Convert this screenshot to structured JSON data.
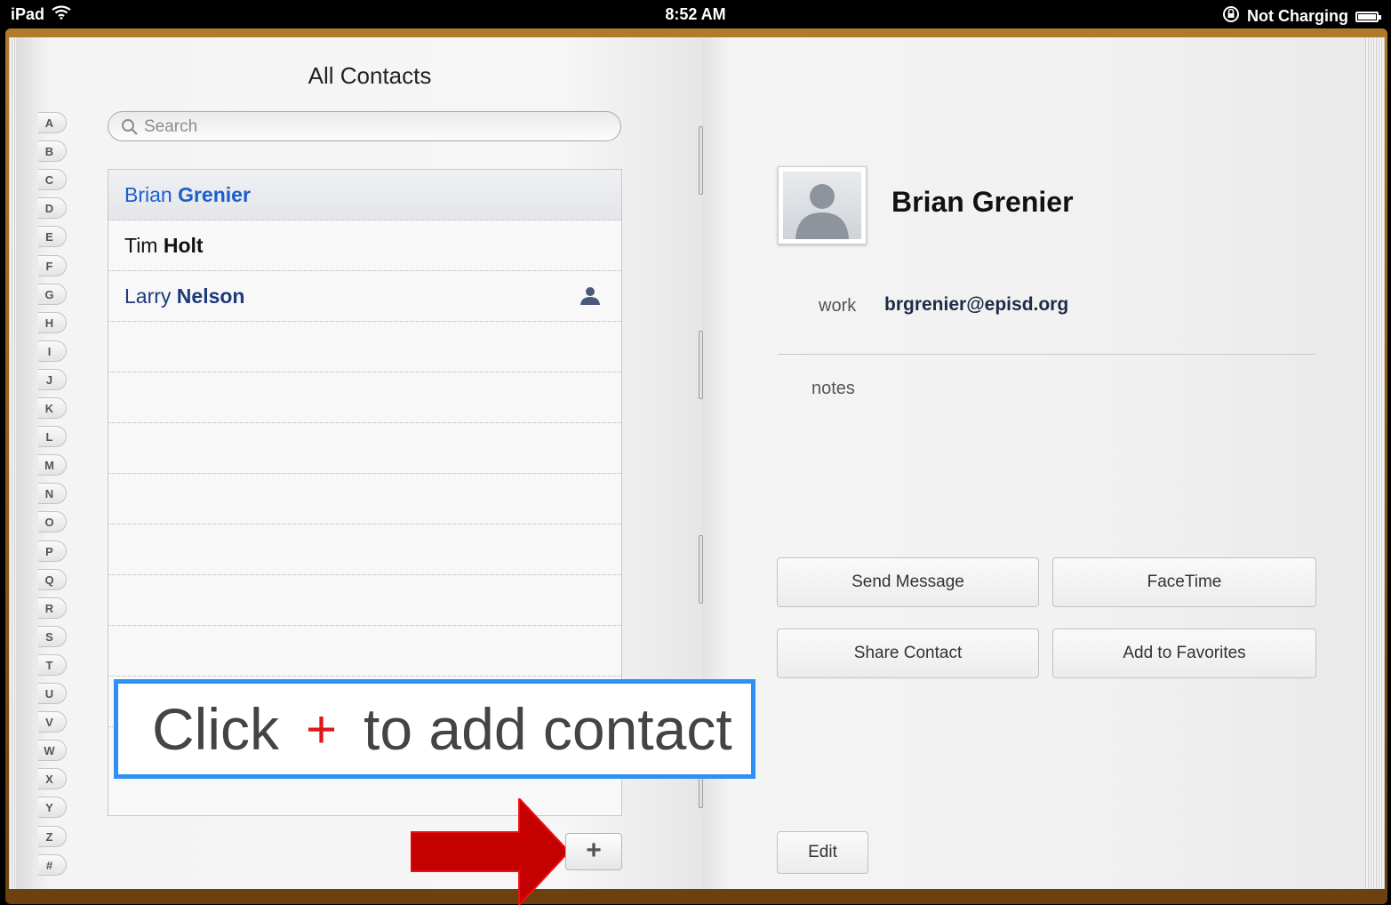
{
  "status_bar": {
    "device": "iPad",
    "time": "8:52 AM",
    "charging": "Not Charging"
  },
  "contacts_list": {
    "title": "All Contacts",
    "search_placeholder": "Search",
    "index_letters": [
      "A",
      "B",
      "C",
      "D",
      "E",
      "F",
      "G",
      "H",
      "I",
      "J",
      "K",
      "L",
      "M",
      "N",
      "O",
      "P",
      "Q",
      "R",
      "S",
      "T",
      "U",
      "V",
      "W",
      "X",
      "Y",
      "Z",
      "#"
    ],
    "contacts": [
      {
        "first": "Brian",
        "last": "Grenier",
        "selected": true,
        "me_card": false
      },
      {
        "first": "Tim",
        "last": "Holt",
        "selected": false,
        "me_card": false
      },
      {
        "first": "Larry",
        "last": "Nelson",
        "selected": false,
        "me_card": true
      }
    ],
    "add_button": "+"
  },
  "callout": {
    "before": "Click",
    "symbol": "+",
    "after": "to add contact"
  },
  "detail": {
    "name": "Brian Grenier",
    "email_label": "work",
    "email": "brgrenier@episd.org",
    "notes_label": "notes",
    "buttons": {
      "send_message": "Send Message",
      "facetime": "FaceTime",
      "share_contact": "Share Contact",
      "add_favorites": "Add to Favorites",
      "edit": "Edit"
    }
  },
  "colors": {
    "selected_text": "#1a5fd0",
    "name_text": "#1e3a7a",
    "callout_border": "#2e8ff5",
    "arrow_red": "#c40000",
    "leather": "#8a5718"
  }
}
